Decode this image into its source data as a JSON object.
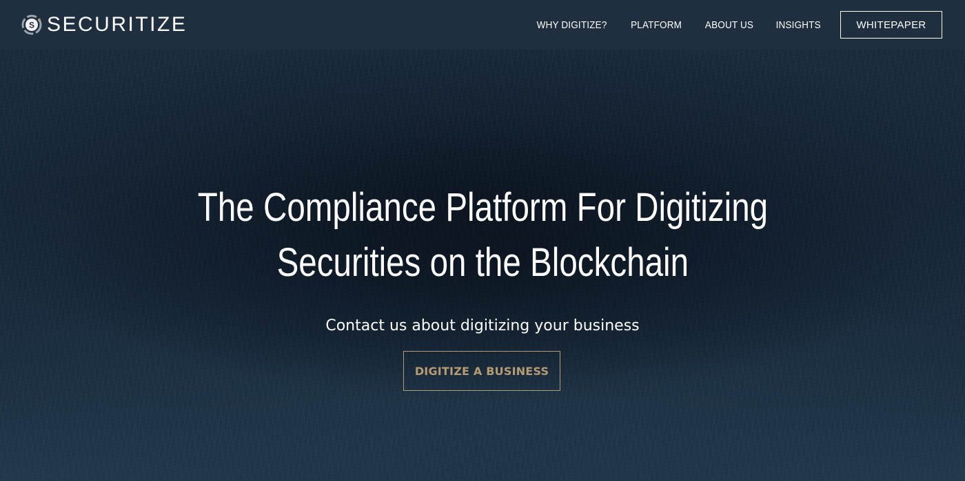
{
  "brand": {
    "name": "SECURITIZE",
    "logo_icon": "securitize-logo-icon",
    "accent_color": "#b79c72"
  },
  "nav": {
    "links": [
      {
        "label": "WHY DIGITIZE?"
      },
      {
        "label": "PLATFORM"
      },
      {
        "label": "ABOUT US"
      },
      {
        "label": "INSIGHTS"
      }
    ],
    "cta_label": "WHITEPAPER"
  },
  "hero": {
    "title_line_1": "The Compliance Platform For Digitizing",
    "title_line_2": "Securities on the Blockchain",
    "subtitle": "Contact us about digitizing your business",
    "cta_label": "DIGITIZE A BUSINESS"
  }
}
